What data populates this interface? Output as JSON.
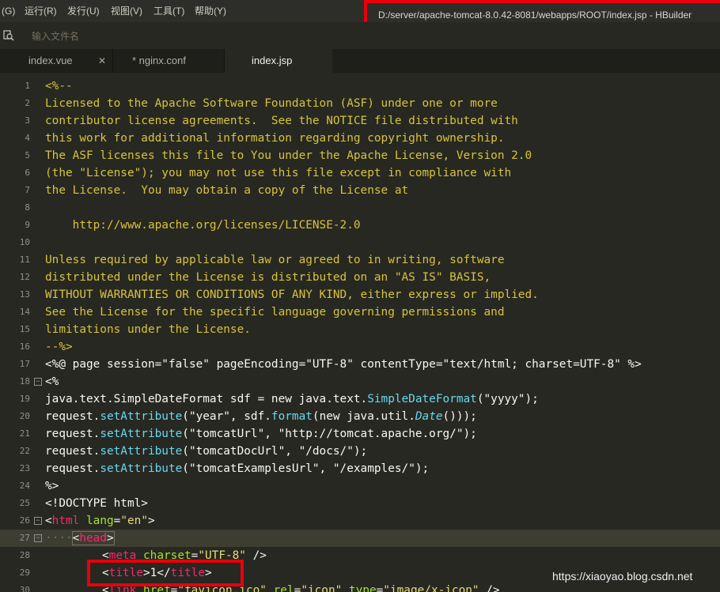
{
  "menu": [
    "(G)",
    "运行(R)",
    "发行(U)",
    "视图(V)",
    "工具(T)",
    "帮助(Y)"
  ],
  "window_title": "D:/server/apache-tomcat-8.0.42-8081/webapps/ROOT/index.jsp - HBuilder",
  "search": {
    "placeholder": "输入文件名",
    "icon": "search-file-icon"
  },
  "tabs": [
    {
      "label": "index.vue",
      "close": "✕"
    },
    {
      "label": "* nginx.conf"
    },
    {
      "label": "index.jsp",
      "active": true
    }
  ],
  "colors": {
    "background": "#272822",
    "comment": "#d8c33a",
    "tag": "#f92672",
    "string": "#e6db74",
    "highlight_box": "#e8000a"
  },
  "code": {
    "numbers": [
      "1",
      "2",
      "3",
      "4",
      "5",
      "6",
      "7",
      "8",
      "9",
      "10",
      "11",
      "12",
      "13",
      "14",
      "15",
      "16",
      "17",
      "18",
      "19",
      "20",
      "21",
      "22",
      "23",
      "24",
      "25",
      "26",
      "27",
      "28",
      "29",
      "30"
    ],
    "comment": [
      "<%--",
      "Licensed to the Apache Software Foundation (ASF) under one or more",
      "contributor license agreements.  See the NOTICE file distributed with",
      "this work for additional information regarding copyright ownership.",
      "The ASF licenses this file to You under the Apache License, Version 2.0",
      "(the \"License\"); you may not use this file except in compliance with",
      "the License.  You may obtain a copy of the License at",
      "",
      "    http://www.apache.org/licenses/LICENSE-2.0",
      "",
      "Unless required by applicable law or agreed to in writing, software",
      "distributed under the License is distributed on an \"AS IS\" BASIS,",
      "WITHOUT WARRANTIES OR CONDITIONS OF ANY KIND, either express or implied.",
      "See the License for the specific language governing permissions and",
      "limitations under the License.",
      "--%>"
    ],
    "l17": "<%@ page session=\"false\" pageEncoding=\"UTF-8\" contentType=\"text/html; charset=UTF-8\" %>",
    "l18": "<%",
    "l19": [
      "java.text.SimpleDateFormat sdf = new java.text.",
      "SimpleDateFormat",
      "(\"yyyy\");"
    ],
    "l20": [
      "request.",
      "setAttribute",
      "(\"year\", sdf.",
      "format",
      "(new java.util.",
      "Date",
      "()));"
    ],
    "l21": [
      "request.",
      "setAttribute",
      "(\"tomcatUrl\", \"http://tomcat.apache.org/\");"
    ],
    "l22": [
      "request.",
      "setAttribute",
      "(\"tomcatDocUrl\", \"/docs/\");"
    ],
    "l23": [
      "request.",
      "setAttribute",
      "(\"tomcatExamplesUrl\", \"/examples/\");"
    ],
    "l24": "%>",
    "l25": "<!DOCTYPE html>",
    "l26": [
      "<",
      "html",
      " ",
      "lang",
      "=",
      "\"en\"",
      ">"
    ],
    "l27": [
      "····",
      "<",
      "head",
      ">"
    ],
    "l28": [
      "<",
      "meta",
      " ",
      "charset",
      "=",
      "\"UTF-8\"",
      " />"
    ],
    "l29": [
      "<",
      "title",
      ">",
      "1",
      "</",
      "title",
      ">"
    ],
    "l30": [
      "<",
      "link",
      " ",
      "href",
      "=",
      "\"favicon.ico\"",
      " ",
      "rel",
      "=",
      "\"icon\"",
      " ",
      "type",
      "=",
      "\"image/x-icon\"",
      " />"
    ]
  },
  "watermark": "https://xiaoyao.blog.csdn.net"
}
